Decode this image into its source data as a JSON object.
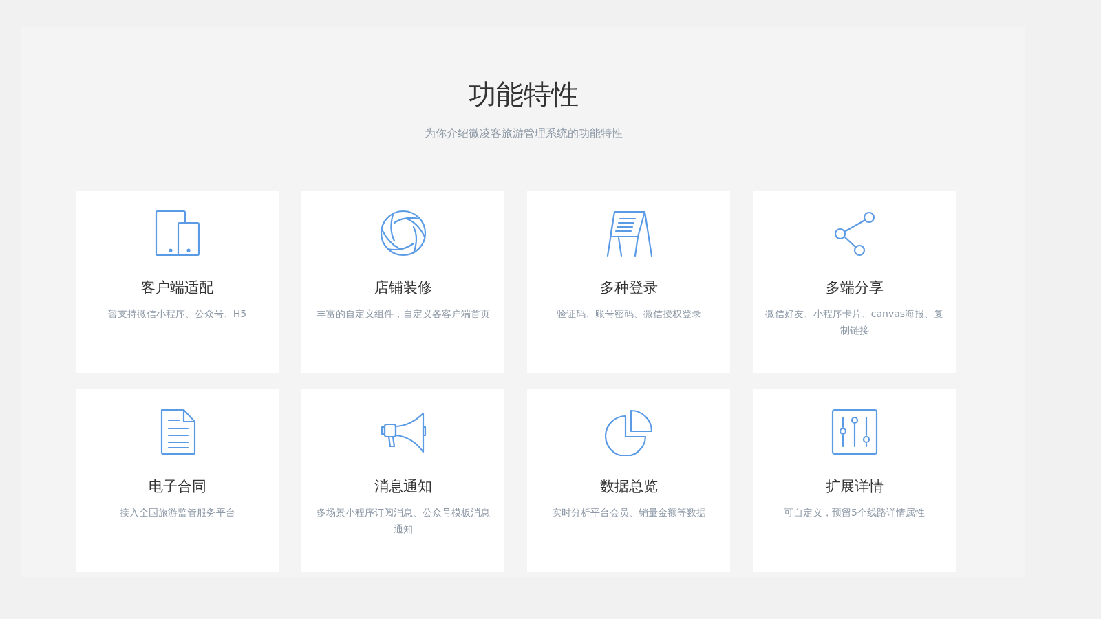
{
  "header": {
    "title": "功能特性",
    "subtitle": "为你介绍微凌客旅游管理系统的功能特性"
  },
  "features": [
    {
      "title": "客户端适配",
      "description": "暂支持微信小程序、公众号、H5"
    },
    {
      "title": "店铺装修",
      "description": "丰富的自定义组件，自定义各客户端首页"
    },
    {
      "title": "多种登录",
      "description": "验证码、账号密码、微信授权登录"
    },
    {
      "title": "多端分享",
      "description": "微信好友、小程序卡片、canvas海报、复制链接"
    },
    {
      "title": "电子合同",
      "description": "接入全国旅游监管服务平台"
    },
    {
      "title": "消息通知",
      "description": "多场景小程序订阅消息、公众号模板消息通知"
    },
    {
      "title": "数据总览",
      "description": "实时分析平台会员、销量金额等数据"
    },
    {
      "title": "扩展详情",
      "description": "可自定义，预留5个线路详情属性"
    }
  ]
}
